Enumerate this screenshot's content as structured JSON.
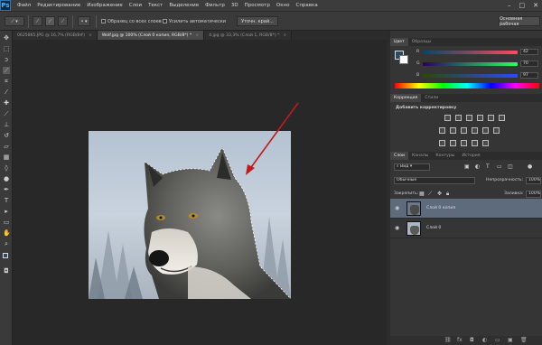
{
  "app": {
    "logo": "Ps"
  },
  "menu": [
    "Файл",
    "Редактирование",
    "Изображение",
    "Слои",
    "Текст",
    "Выделение",
    "Фильтр",
    "3D",
    "Просмотр",
    "Окно",
    "Справка"
  ],
  "options": {
    "checkbox1": "Образец со всех слоев",
    "checkbox2": "Усилить автоматически",
    "refine_button": "Уточн. край..."
  },
  "workspace_label": "Основная рабочая",
  "tabs": [
    {
      "label": "0625865.JPG @ 16,7% (RGB/8#)",
      "active": false
    },
    {
      "label": "Wolf.jpg @ 100% (Слой 0 копия, RGB/8*) *",
      "active": true
    },
    {
      "label": "4.jpg @ 33,3% (Слой 1, RGB/8*) *",
      "active": false
    }
  ],
  "color_panel": {
    "tabs": [
      "Цвет",
      "Образцы"
    ],
    "r_label": "R",
    "g_label": "G",
    "b_label": "B",
    "r_value": "42",
    "g_value": "70",
    "b_value": "97",
    "foreground": "#2a4a68"
  },
  "adjustments_panel": {
    "tabs": [
      "Коррекция",
      "Стили"
    ],
    "heading": "Добавить корректировку"
  },
  "layers_panel": {
    "tabs": [
      "Слои",
      "Каналы",
      "Контуры",
      "История"
    ],
    "filter_label": "Вид",
    "blend_mode": "Обычные",
    "opacity_label": "Непрозрачность:",
    "opacity_value": "100%",
    "lock_label": "Закрепить:",
    "fill_label": "Заливка:",
    "fill_value": "100%",
    "layers": [
      {
        "name": "Слой 0 копия",
        "selected": true
      },
      {
        "name": "Слой 0",
        "selected": false
      }
    ]
  },
  "colors": {
    "accent": "#c11a1a",
    "selected_row": "#5d6b7d"
  }
}
